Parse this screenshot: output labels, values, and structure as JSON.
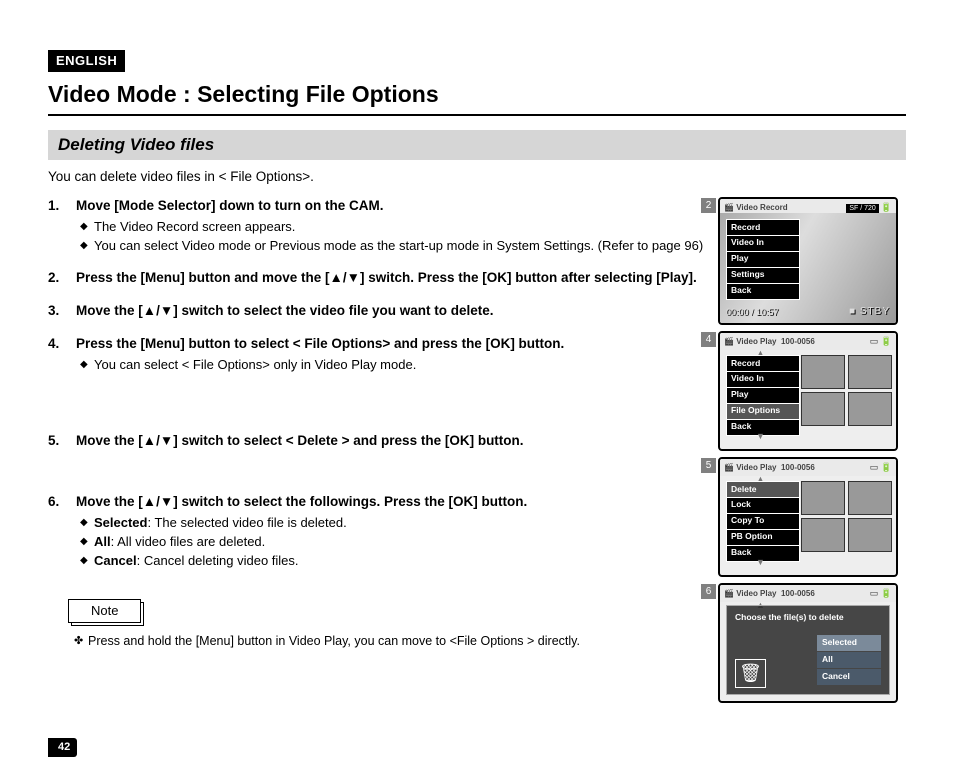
{
  "lang_badge": "ENGLISH",
  "title": "Video Mode : Selecting File Options",
  "subtitle": "Deleting Video files",
  "intro": "You can delete video files in < File Options>.",
  "steps": [
    {
      "title": "Move [Mode Selector] down to turn on the CAM.",
      "subs": [
        "The Video Record screen appears.",
        "You can select Video mode or Previous mode as the start-up mode in System Settings. (Refer to page 96)"
      ]
    },
    {
      "title": "Press the [Menu] button and move the [▲/▼] switch. Press the [OK] button after selecting [Play].",
      "subs": []
    },
    {
      "title": "Move the [▲/▼] switch to select the video file you want to delete.",
      "subs": []
    },
    {
      "title": "Press the [Menu] button to select < File Options> and press the [OK] button.",
      "subs": [
        "You can select < File Options> only in Video Play mode."
      ]
    },
    {
      "title": "Move the [▲/▼] switch to select < Delete > and press the [OK] button.",
      "subs": []
    },
    {
      "title": "Move the [▲/▼] switch to select the followings. Press the [OK] button.",
      "subs": [
        "Selected: The selected video file is deleted.",
        "All: All video files are deleted.",
        "Cancel: Cancel deleting video files."
      ],
      "sub_bold_terms": [
        "Selected",
        "All",
        "Cancel"
      ]
    }
  ],
  "note_label": "Note",
  "note_text": "Press and hold the [Menu] button in Video Play, you can move to <File Options > directly.",
  "page_number": "42",
  "screens": {
    "s2": {
      "num": "2",
      "header_title": "Video Record",
      "header_right": "SF / 720",
      "menu": [
        "Record",
        "Video In",
        "Play",
        "Settings",
        "Back"
      ],
      "timecode": "00:00 / 10:57",
      "status": "■ STBY"
    },
    "s4": {
      "num": "4",
      "header_title": "Video Play",
      "header_right": "100-0056",
      "menu": [
        "Record",
        "Video In",
        "Play",
        "File Options",
        "Back"
      ],
      "selected_index": 3
    },
    "s5": {
      "num": "5",
      "header_title": "Video Play",
      "header_right": "100-0056",
      "menu": [
        "Delete",
        "Lock",
        "Copy To",
        "PB Option",
        "Back"
      ],
      "selected_index": 0
    },
    "s6": {
      "num": "6",
      "header_title": "Video Play",
      "header_right": "100-0056",
      "dialog_msg": "Choose the file(s) to delete",
      "options": [
        "Selected",
        "All",
        "Cancel"
      ],
      "selected_index": 0
    }
  }
}
